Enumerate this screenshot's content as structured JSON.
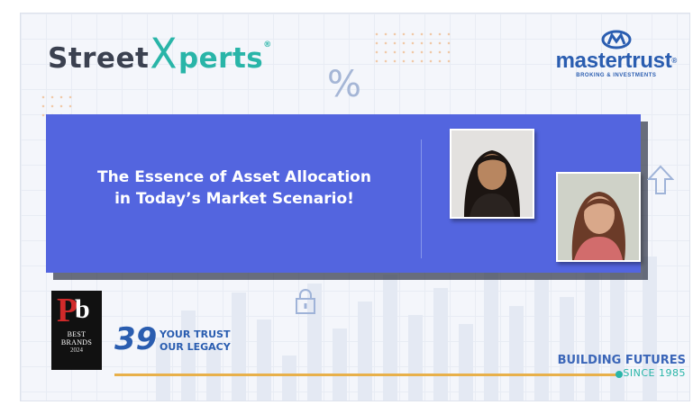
{
  "brand": {
    "street_prefix": "Street",
    "street_x": "X",
    "street_suffix": "perts",
    "street_mark": "®",
    "mastertrust_name": "mastertrust",
    "mastertrust_mark": "®",
    "mastertrust_tagline": "BROKING & INVESTMENTS"
  },
  "banner": {
    "headline_line1": "The Essence of Asset Allocation",
    "headline_line2": "in Today’s Market Scenario!"
  },
  "decor": {
    "percent_symbol": "%"
  },
  "footer": {
    "award_logo_letters": "Pb",
    "award_line1": "BEST",
    "award_line2": "BRANDS",
    "award_year": "2024",
    "legacy_number": "39",
    "legacy_line1": "YOUR TRUST",
    "legacy_line2": "OUR LEGACY",
    "building_line": "BUILDING FUTURES",
    "since_line": "SINCE 1985"
  },
  "colors": {
    "banner": "#5365df",
    "accent_teal": "#29b5a8",
    "brand_blue": "#2a5db0",
    "timeline": "#e8b04a"
  },
  "icons": [
    "percent-icon",
    "up-arrow-icon",
    "lock-icon",
    "mastertrust-logo-icon"
  ]
}
